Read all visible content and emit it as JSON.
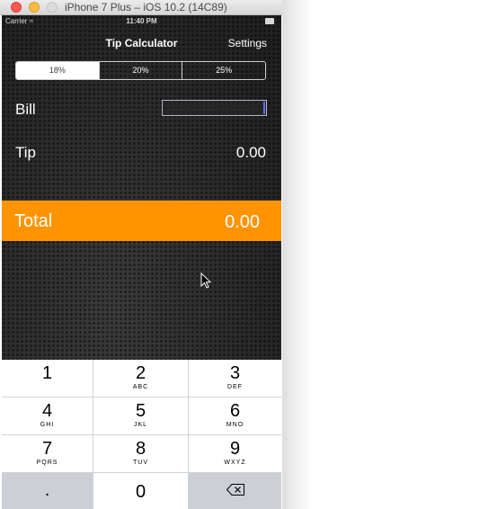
{
  "window": {
    "title": "iPhone 7 Plus – iOS 10.2 (14C89)"
  },
  "status_bar": {
    "carrier": "Carrier",
    "time": "11:40 PM"
  },
  "nav": {
    "title": "Tip Calculator",
    "settings": "Settings"
  },
  "segments": [
    {
      "label": "18%",
      "selected": true
    },
    {
      "label": "20%",
      "selected": false
    },
    {
      "label": "25%",
      "selected": false
    }
  ],
  "bill": {
    "label": "Bill",
    "value": ""
  },
  "tip": {
    "label": "Tip",
    "value": "0.00"
  },
  "total": {
    "label": "Total",
    "value": "0.00"
  },
  "keypad": [
    {
      "num": "1",
      "letters": ""
    },
    {
      "num": "2",
      "letters": "ABC"
    },
    {
      "num": "3",
      "letters": "DEF"
    },
    {
      "num": "4",
      "letters": "GHI"
    },
    {
      "num": "5",
      "letters": "JKL"
    },
    {
      "num": "6",
      "letters": "MNO"
    },
    {
      "num": "7",
      "letters": "PQRS"
    },
    {
      "num": "8",
      "letters": "TUV"
    },
    {
      "num": "9",
      "letters": "WXYZ"
    },
    {
      "num": ".",
      "letters": ""
    },
    {
      "num": "0",
      "letters": ""
    },
    {
      "num": "",
      "letters": "",
      "icon": "backspace-icon"
    }
  ],
  "colors": {
    "accent": "#ff9400",
    "keypad_bg": "#ffffff",
    "keypad_dark": "#ccd0d6"
  }
}
